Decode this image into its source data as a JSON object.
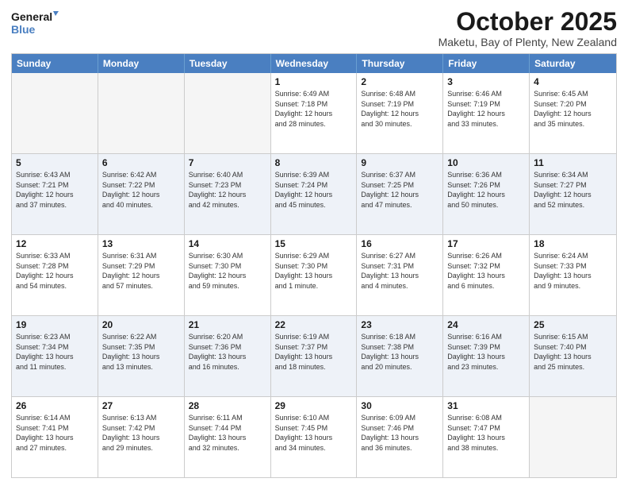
{
  "header": {
    "logo_line1": "General",
    "logo_line2": "Blue",
    "month": "October 2025",
    "location": "Maketu, Bay of Plenty, New Zealand"
  },
  "days": [
    "Sunday",
    "Monday",
    "Tuesday",
    "Wednesday",
    "Thursday",
    "Friday",
    "Saturday"
  ],
  "weeks": [
    [
      {
        "day": "",
        "text": ""
      },
      {
        "day": "",
        "text": ""
      },
      {
        "day": "",
        "text": ""
      },
      {
        "day": "1",
        "text": "Sunrise: 6:49 AM\nSunset: 7:18 PM\nDaylight: 12 hours\nand 28 minutes."
      },
      {
        "day": "2",
        "text": "Sunrise: 6:48 AM\nSunset: 7:19 PM\nDaylight: 12 hours\nand 30 minutes."
      },
      {
        "day": "3",
        "text": "Sunrise: 6:46 AM\nSunset: 7:19 PM\nDaylight: 12 hours\nand 33 minutes."
      },
      {
        "day": "4",
        "text": "Sunrise: 6:45 AM\nSunset: 7:20 PM\nDaylight: 12 hours\nand 35 minutes."
      }
    ],
    [
      {
        "day": "5",
        "text": "Sunrise: 6:43 AM\nSunset: 7:21 PM\nDaylight: 12 hours\nand 37 minutes."
      },
      {
        "day": "6",
        "text": "Sunrise: 6:42 AM\nSunset: 7:22 PM\nDaylight: 12 hours\nand 40 minutes."
      },
      {
        "day": "7",
        "text": "Sunrise: 6:40 AM\nSunset: 7:23 PM\nDaylight: 12 hours\nand 42 minutes."
      },
      {
        "day": "8",
        "text": "Sunrise: 6:39 AM\nSunset: 7:24 PM\nDaylight: 12 hours\nand 45 minutes."
      },
      {
        "day": "9",
        "text": "Sunrise: 6:37 AM\nSunset: 7:25 PM\nDaylight: 12 hours\nand 47 minutes."
      },
      {
        "day": "10",
        "text": "Sunrise: 6:36 AM\nSunset: 7:26 PM\nDaylight: 12 hours\nand 50 minutes."
      },
      {
        "day": "11",
        "text": "Sunrise: 6:34 AM\nSunset: 7:27 PM\nDaylight: 12 hours\nand 52 minutes."
      }
    ],
    [
      {
        "day": "12",
        "text": "Sunrise: 6:33 AM\nSunset: 7:28 PM\nDaylight: 12 hours\nand 54 minutes."
      },
      {
        "day": "13",
        "text": "Sunrise: 6:31 AM\nSunset: 7:29 PM\nDaylight: 12 hours\nand 57 minutes."
      },
      {
        "day": "14",
        "text": "Sunrise: 6:30 AM\nSunset: 7:30 PM\nDaylight: 12 hours\nand 59 minutes."
      },
      {
        "day": "15",
        "text": "Sunrise: 6:29 AM\nSunset: 7:30 PM\nDaylight: 13 hours\nand 1 minute."
      },
      {
        "day": "16",
        "text": "Sunrise: 6:27 AM\nSunset: 7:31 PM\nDaylight: 13 hours\nand 4 minutes."
      },
      {
        "day": "17",
        "text": "Sunrise: 6:26 AM\nSunset: 7:32 PM\nDaylight: 13 hours\nand 6 minutes."
      },
      {
        "day": "18",
        "text": "Sunrise: 6:24 AM\nSunset: 7:33 PM\nDaylight: 13 hours\nand 9 minutes."
      }
    ],
    [
      {
        "day": "19",
        "text": "Sunrise: 6:23 AM\nSunset: 7:34 PM\nDaylight: 13 hours\nand 11 minutes."
      },
      {
        "day": "20",
        "text": "Sunrise: 6:22 AM\nSunset: 7:35 PM\nDaylight: 13 hours\nand 13 minutes."
      },
      {
        "day": "21",
        "text": "Sunrise: 6:20 AM\nSunset: 7:36 PM\nDaylight: 13 hours\nand 16 minutes."
      },
      {
        "day": "22",
        "text": "Sunrise: 6:19 AM\nSunset: 7:37 PM\nDaylight: 13 hours\nand 18 minutes."
      },
      {
        "day": "23",
        "text": "Sunrise: 6:18 AM\nSunset: 7:38 PM\nDaylight: 13 hours\nand 20 minutes."
      },
      {
        "day": "24",
        "text": "Sunrise: 6:16 AM\nSunset: 7:39 PM\nDaylight: 13 hours\nand 23 minutes."
      },
      {
        "day": "25",
        "text": "Sunrise: 6:15 AM\nSunset: 7:40 PM\nDaylight: 13 hours\nand 25 minutes."
      }
    ],
    [
      {
        "day": "26",
        "text": "Sunrise: 6:14 AM\nSunset: 7:41 PM\nDaylight: 13 hours\nand 27 minutes."
      },
      {
        "day": "27",
        "text": "Sunrise: 6:13 AM\nSunset: 7:42 PM\nDaylight: 13 hours\nand 29 minutes."
      },
      {
        "day": "28",
        "text": "Sunrise: 6:11 AM\nSunset: 7:44 PM\nDaylight: 13 hours\nand 32 minutes."
      },
      {
        "day": "29",
        "text": "Sunrise: 6:10 AM\nSunset: 7:45 PM\nDaylight: 13 hours\nand 34 minutes."
      },
      {
        "day": "30",
        "text": "Sunrise: 6:09 AM\nSunset: 7:46 PM\nDaylight: 13 hours\nand 36 minutes."
      },
      {
        "day": "31",
        "text": "Sunrise: 6:08 AM\nSunset: 7:47 PM\nDaylight: 13 hours\nand 38 minutes."
      },
      {
        "day": "",
        "text": ""
      }
    ]
  ]
}
